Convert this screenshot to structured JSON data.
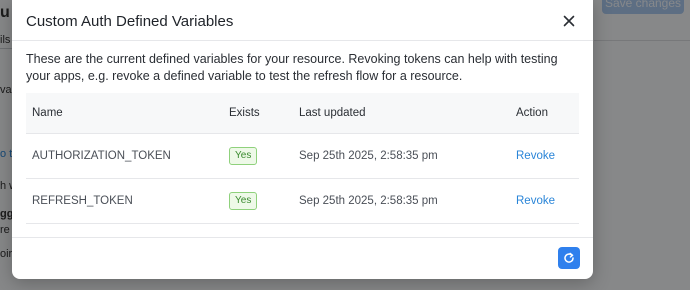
{
  "modal": {
    "title": "Custom Auth Defined Variables",
    "description": "These are the current defined variables for your resource. Revoking tokens can help with testing your apps, e.g. revoke a defined variable to test the refresh flow for a resource.",
    "table": {
      "headers": [
        "Name",
        "Exists",
        "Last updated",
        "Action"
      ],
      "rows": [
        {
          "name": "AUTHORIZATION_TOKEN",
          "exists": "Yes",
          "last_updated": "Sep 25th 2025, 2:58:35 pm",
          "action": "Revoke"
        },
        {
          "name": "REFRESH_TOKEN",
          "exists": "Yes",
          "last_updated": "Sep 25th 2025, 2:58:35 pm",
          "action": "Revoke"
        }
      ]
    },
    "close_icon": "close-icon",
    "refresh_icon": "refresh-icon"
  },
  "background": {
    "top_button_label": "Save changes",
    "fragments": [
      "u",
      "ils",
      "vari",
      "o th",
      "h w",
      "gge",
      "re",
      "oira"
    ]
  },
  "colors": {
    "accent": "#2f80ed",
    "link": "#2a85d8",
    "badge_border": "#8fd17c",
    "badge_text": "#3a8b2f"
  }
}
